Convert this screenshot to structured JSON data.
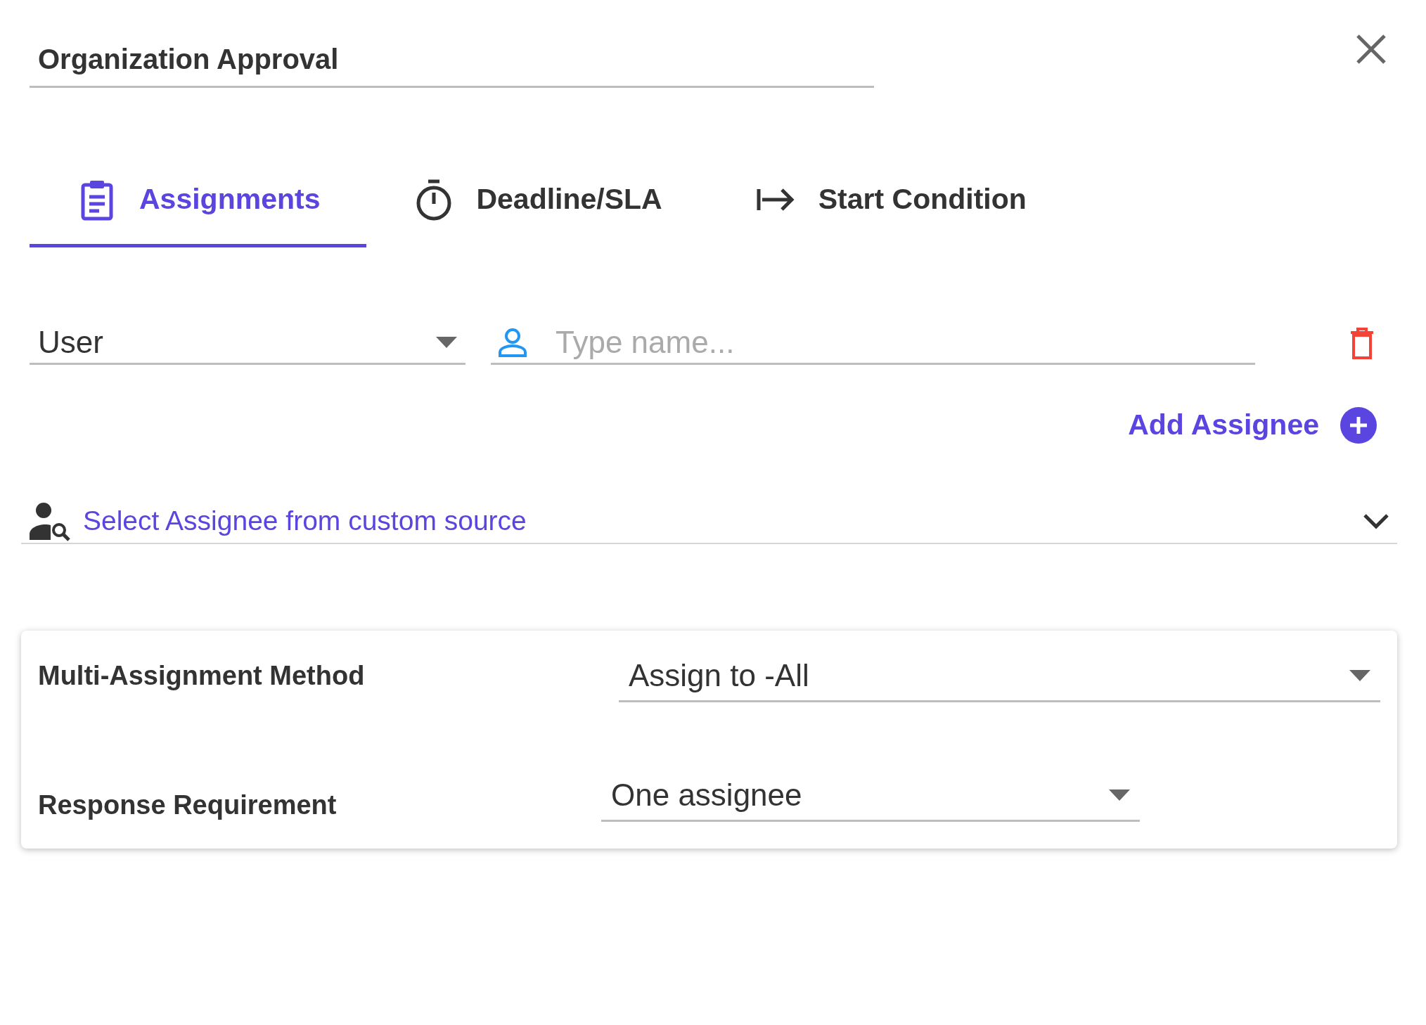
{
  "dialog": {
    "title": "Organization Approval"
  },
  "tabs": [
    {
      "label": "Assignments",
      "selected": true,
      "kind": "clipboard"
    },
    {
      "label": "Deadline/SLA",
      "selected": false,
      "kind": "timer"
    },
    {
      "label": "Start Condition",
      "selected": false,
      "kind": "arrow"
    }
  ],
  "assignee_row": {
    "type_select": "User",
    "name_field": {
      "placeholder": "Type name..."
    }
  },
  "add_assignee": {
    "label": "Add Assignee"
  },
  "custom_source": {
    "label": "Select Assignee from custom source",
    "expanded": false
  },
  "settings": [
    {
      "label": "Multi-Assignment Method",
      "value": "Assign to -All"
    },
    {
      "label": "Response Requirement",
      "value": "One assignee"
    }
  ]
}
